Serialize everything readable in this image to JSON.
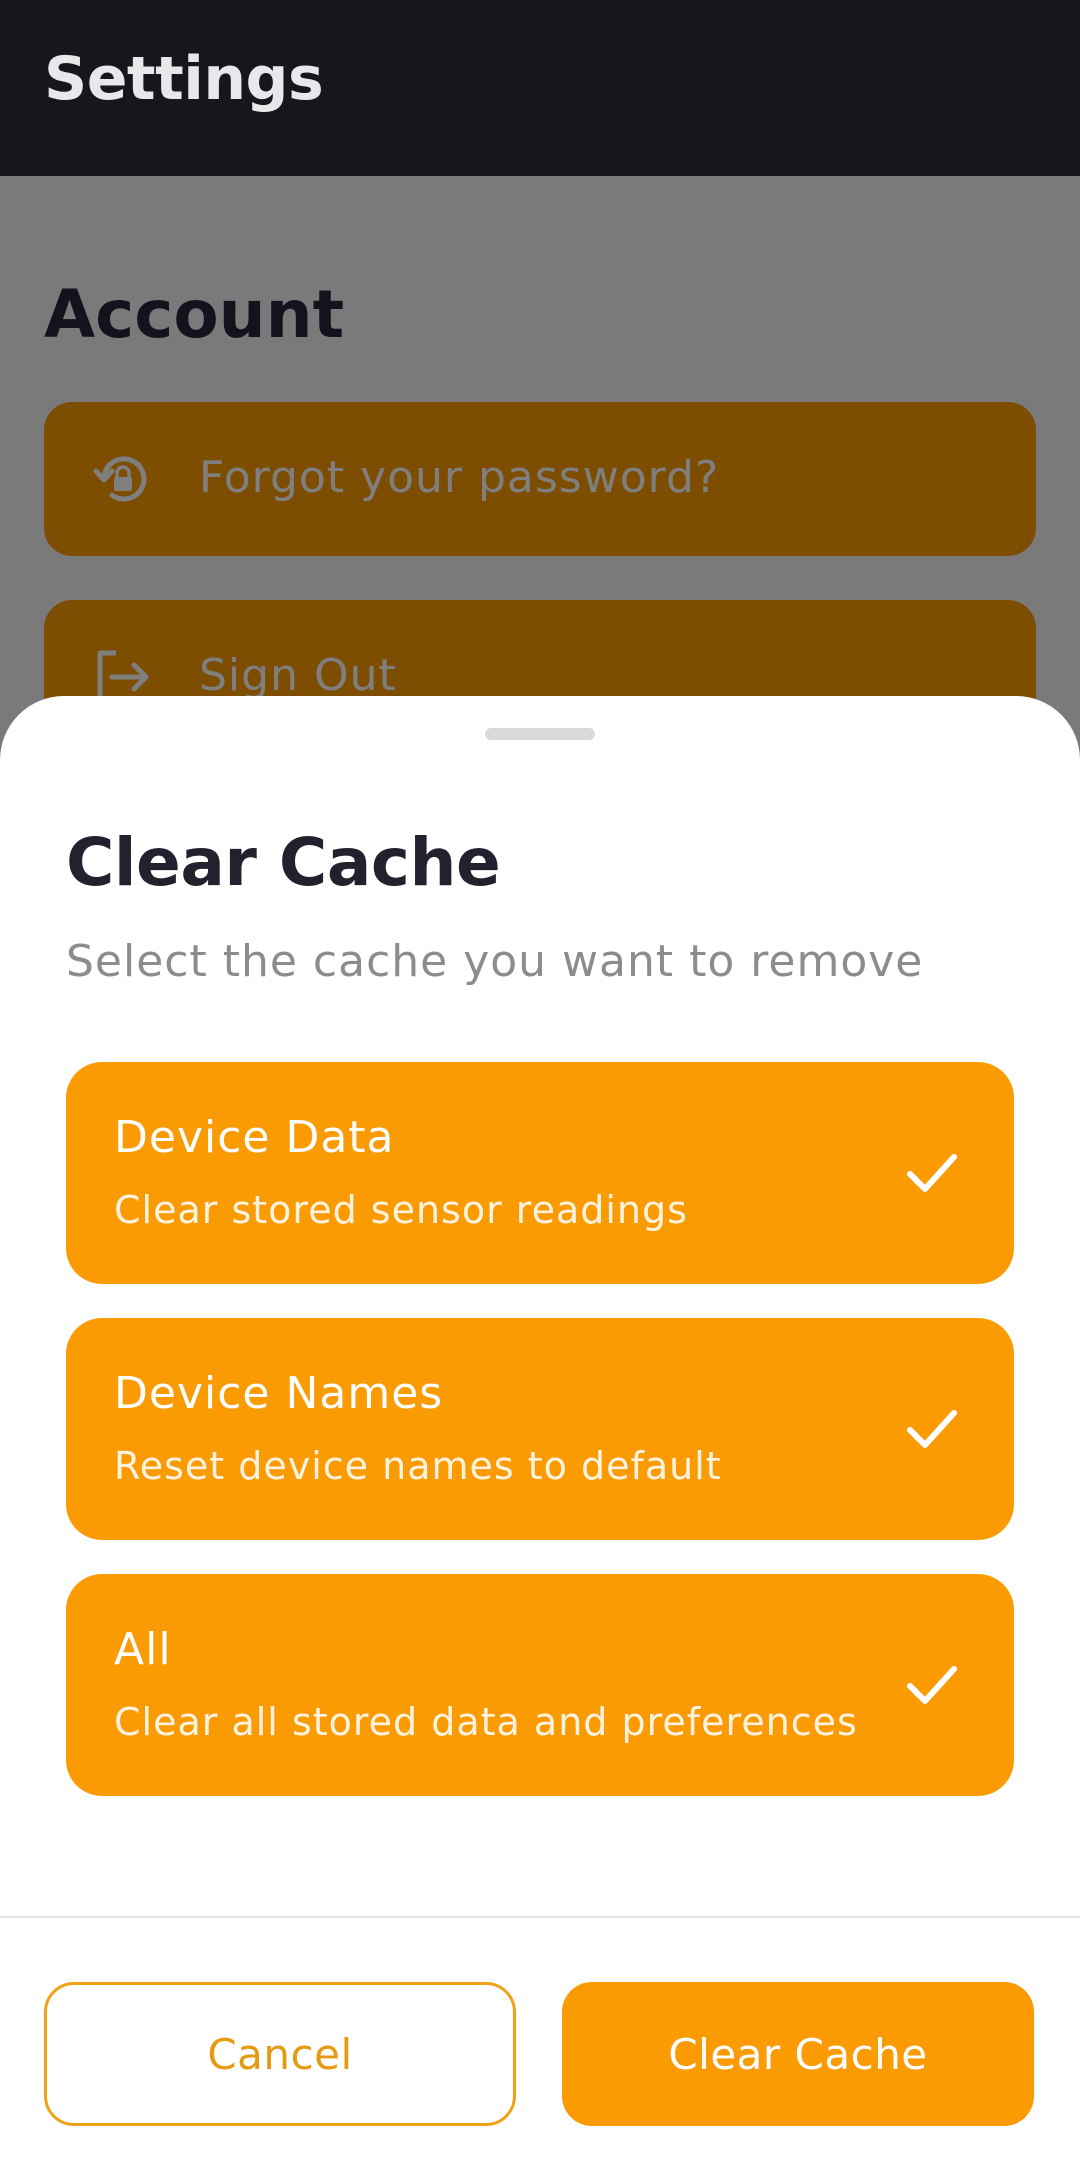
{
  "header": {
    "title": "Settings"
  },
  "account": {
    "section_title": "Account",
    "items": [
      {
        "label": "Forgot your password?",
        "icon": "lock-reset-icon"
      },
      {
        "label": "Sign Out",
        "icon": "sign-out-icon"
      }
    ]
  },
  "sheet": {
    "title": "Clear Cache",
    "subtitle": "Select the cache you want to remove",
    "options": [
      {
        "title": "Device Data",
        "description": "Clear stored sensor readings",
        "selected": true
      },
      {
        "title": "Device Names",
        "description": "Reset device names to default",
        "selected": true
      },
      {
        "title": "All",
        "description": "Clear all stored data and preferences",
        "selected": true
      }
    ],
    "cancel_label": "Cancel",
    "confirm_label": "Clear Cache"
  },
  "colors": {
    "accent": "#fb9b04",
    "header_bg": "#16161d",
    "title_text": "#22222e",
    "muted_text": "#8b8b90"
  }
}
